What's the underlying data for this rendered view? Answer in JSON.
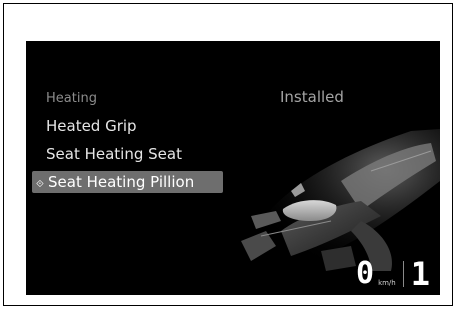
{
  "menu": {
    "title": "Heating",
    "status": "Installed",
    "items": [
      {
        "label": "Heated Grip"
      },
      {
        "label": "Seat Heating Seat"
      },
      {
        "label": "Seat Heating Pillion",
        "selected": true
      }
    ]
  },
  "speedometer": {
    "speed": "0",
    "unit": "km/h",
    "gear": "1"
  },
  "icons": {
    "selected_item": "chevron-right-icon",
    "illustration": "motorcycle-seat-illustration"
  },
  "colors": {
    "screen_bg": "#000000",
    "selection_bg": "#6e6e6e",
    "text": "#e6e6e6",
    "muted": "#8c8c8c"
  }
}
